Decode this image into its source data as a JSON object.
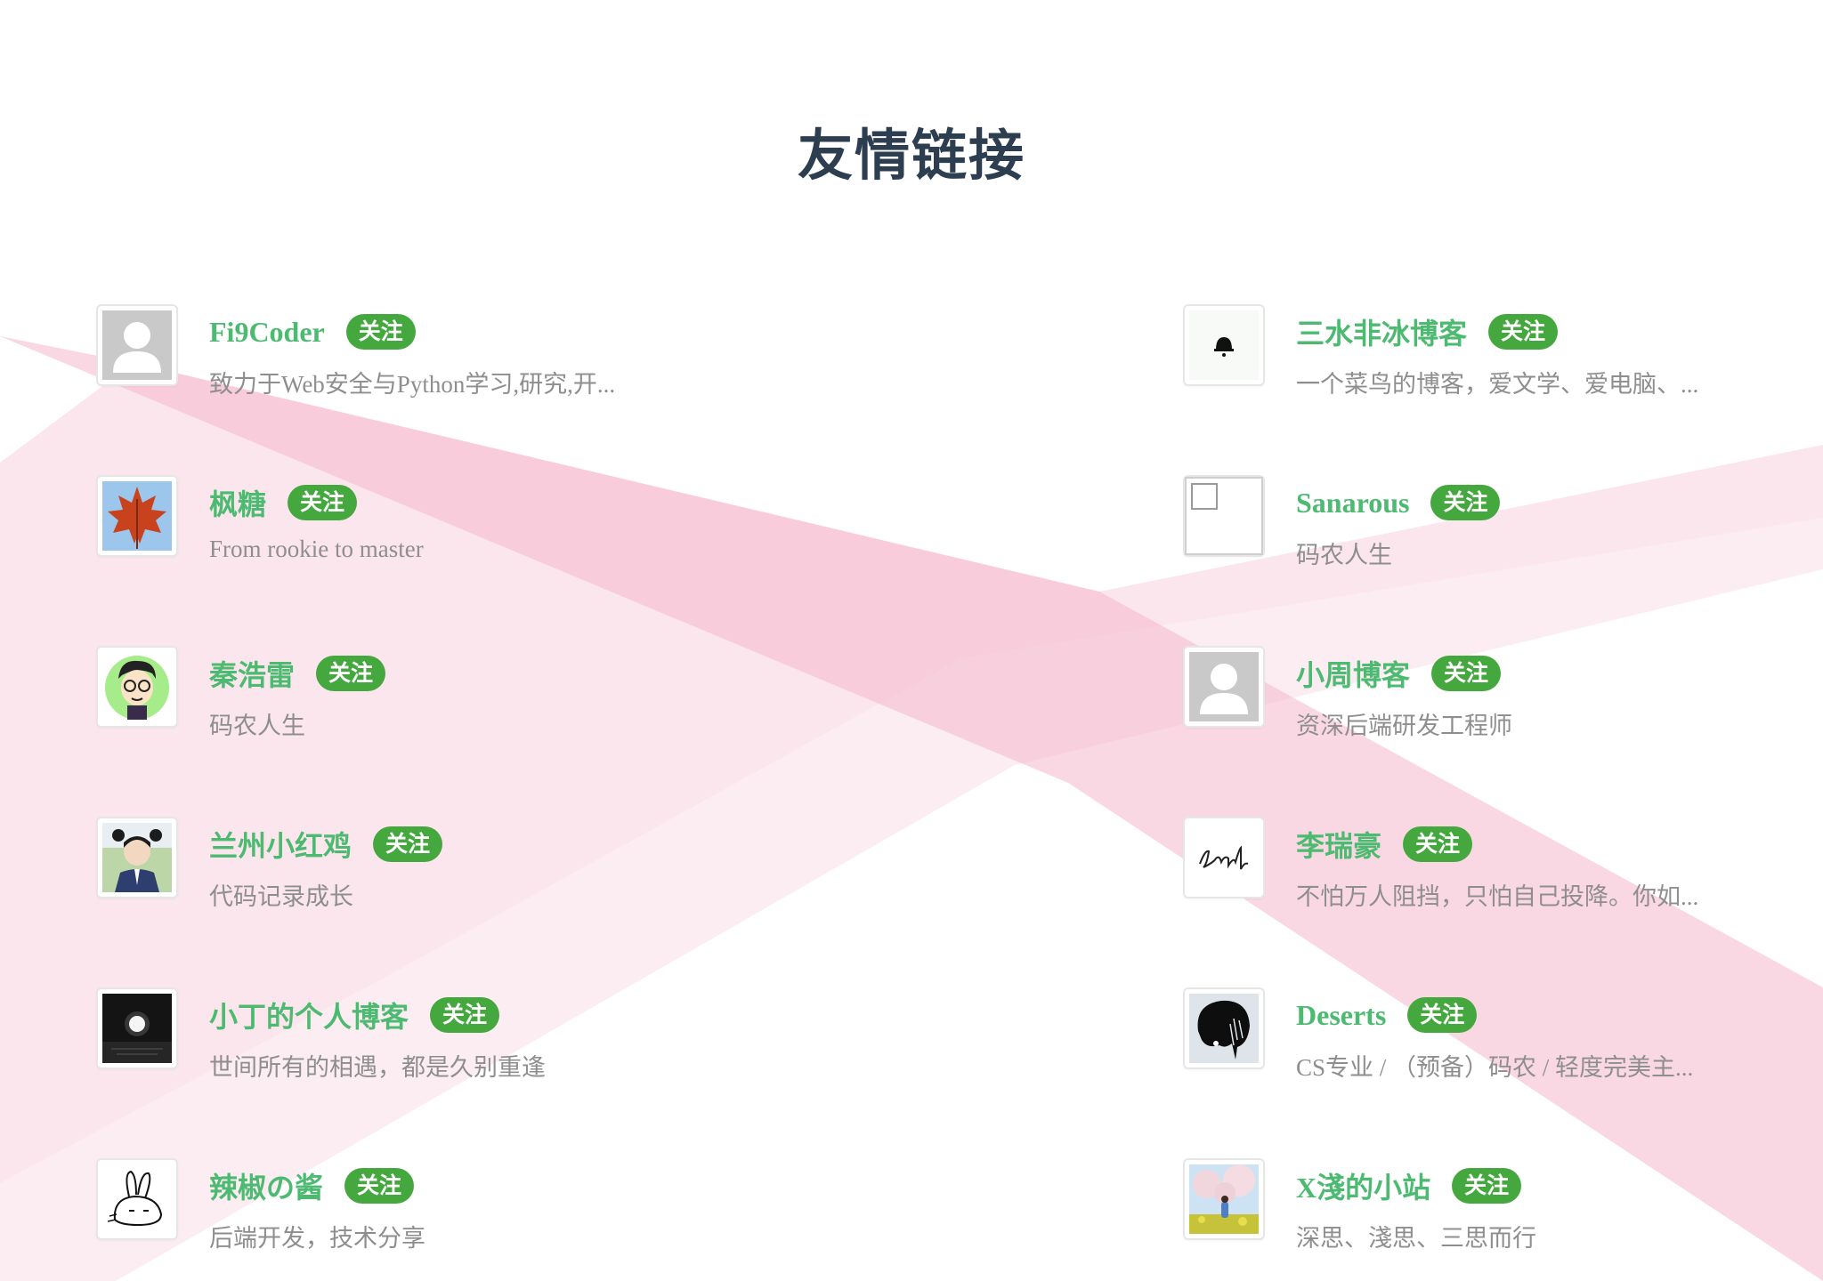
{
  "page": {
    "title": "友情链接",
    "follow_label": "关注"
  },
  "colors": {
    "name": "#4cba70",
    "badge": "#45a83e",
    "desc": "#8e8e8e",
    "title": "#2c3e50",
    "ribbon": "#f5b8cc"
  },
  "links": {
    "left": [
      {
        "name": "Fi9Coder",
        "desc": "致力于Web安全与Python学习,研究,开...",
        "avatar": "default-user-avatar"
      },
      {
        "name": "枫糖",
        "desc": "From rookie to master",
        "avatar": "maple-leaf-avatar"
      },
      {
        "name": "秦浩雷",
        "desc": "码农人生",
        "avatar": "cartoon-boy-glasses-avatar"
      },
      {
        "name": "兰州小红鸡",
        "desc": "代码记录成长",
        "avatar": "anime-student-avatar"
      },
      {
        "name": "小丁的个人博客",
        "desc": "世间所有的相遇，都是久别重逢",
        "avatar": "night-moon-avatar"
      },
      {
        "name": "辣椒の酱",
        "desc": "后端开发，技术分享",
        "avatar": "rabbit-sketch-avatar"
      }
    ],
    "right": [
      {
        "name": "三水非冰博客",
        "desc": "一个菜鸟的博客，爱文学、爱电脑、...",
        "avatar": "bell-avatar"
      },
      {
        "name": "Sanarous",
        "desc": "码农人生",
        "avatar": "broken-image-avatar"
      },
      {
        "name": "小周博客",
        "desc": "资深后端研发工程师",
        "avatar": "default-user-avatar"
      },
      {
        "name": "李瑞豪",
        "desc": "不怕万人阻挡，只怕自己投降。你如...",
        "avatar": "signature-avatar"
      },
      {
        "name": "Deserts",
        "desc": "CS专业 / （预备）码农 / 轻度完美主...",
        "avatar": "silhouette-sketch-avatar"
      },
      {
        "name": "X淺的小站",
        "desc": "深思、淺思、三思而行",
        "avatar": "cherry-blossom-photo-avatar"
      }
    ]
  }
}
